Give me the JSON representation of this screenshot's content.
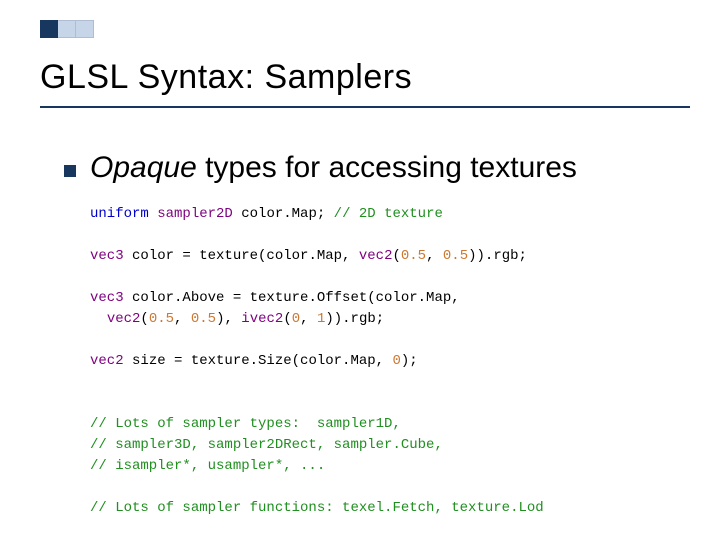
{
  "slide": {
    "title": "GLSL Syntax:  Samplers",
    "bullet": {
      "emph": "Opaque",
      "rest": " types for accessing textures"
    },
    "code": {
      "l01_kw1": "uniform",
      "l01_sp1": " ",
      "l01_ty1": "sampler2D",
      "l01_sp2": " color.Map; ",
      "l01_cm1": "// 2D texture",
      "l02_ty1": "vec3",
      "l02_tx1": " color = texture(color.Map, ",
      "l02_ty2": "vec2",
      "l02_tx2": "(",
      "l02_n1": "0.5",
      "l02_tx3": ", ",
      "l02_n2": "0.5",
      "l02_tx4": ")).rgb;",
      "l03a_ty1": "vec3",
      "l03a_tx1": " color.Above = texture.Offset(color.Map,",
      "l03b_pad": "  ",
      "l03b_ty1": "vec2",
      "l03b_tx1": "(",
      "l03b_n1": "0.5",
      "l03b_tx2": ", ",
      "l03b_n2": "0.5",
      "l03b_tx3": "), ",
      "l03b_ty2": "ivec2",
      "l03b_tx4": "(",
      "l03b_n3": "0",
      "l03b_tx5": ", ",
      "l03b_n4": "1",
      "l03b_tx6": ")).rgb;",
      "l04_ty1": "vec2",
      "l04_tx1": " size = texture.Size(color.Map, ",
      "l04_n1": "0",
      "l04_tx2": ");",
      "l05": "// Lots of sampler types:  sampler1D,",
      "l06": "// sampler3D, sampler2DRect, sampler.Cube,",
      "l07": "// isampler*, usampler*, ...",
      "l08": "// Lots of sampler functions: texel.Fetch, texture.Lod"
    }
  }
}
